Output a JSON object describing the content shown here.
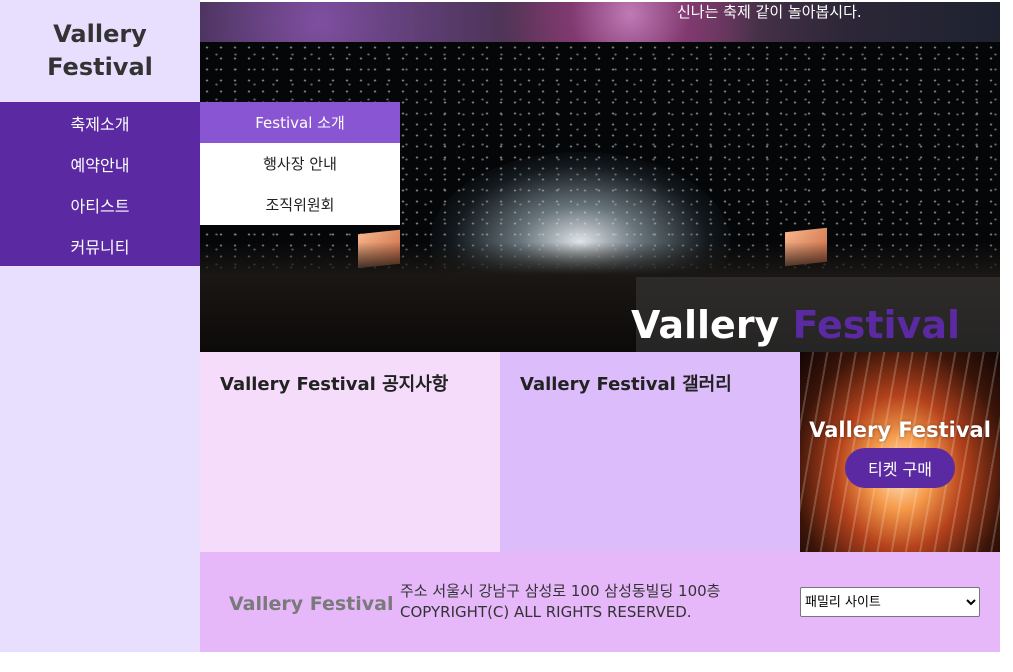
{
  "sidebar": {
    "logo": "Vallery Festival",
    "nav": [
      {
        "label": "축제소개"
      },
      {
        "label": "예약안내"
      },
      {
        "label": "아티스트"
      },
      {
        "label": "커뮤니티"
      }
    ]
  },
  "submenu": [
    {
      "label": "Festival 소개"
    },
    {
      "label": "행사장 안내"
    },
    {
      "label": "조직위원회"
    }
  ],
  "topbar": {
    "text": "신나는 축제 같이 놀아봅시다."
  },
  "hero": {
    "title_main": "Vallery",
    "title_accent": "Festival"
  },
  "notice": {
    "title": "Vallery Festival 공지사항"
  },
  "gallery": {
    "title": "Vallery Festival 갤러리"
  },
  "ticket": {
    "title": "Vallery Festival",
    "button": "티켓 구매"
  },
  "footer": {
    "logo": "Vallery Festival",
    "address": "주소 서울시 강남구 삼성로 100 삼성동빌딩 100층",
    "copyright": "COPYRIGHT(C) ALL RIGHTS RESERVED.",
    "select": "패밀리 사이트"
  },
  "colors": {
    "accent": "#5b2aa3",
    "submenu_active": "#8a55d2",
    "sidebar_bg": "#e8defd"
  }
}
